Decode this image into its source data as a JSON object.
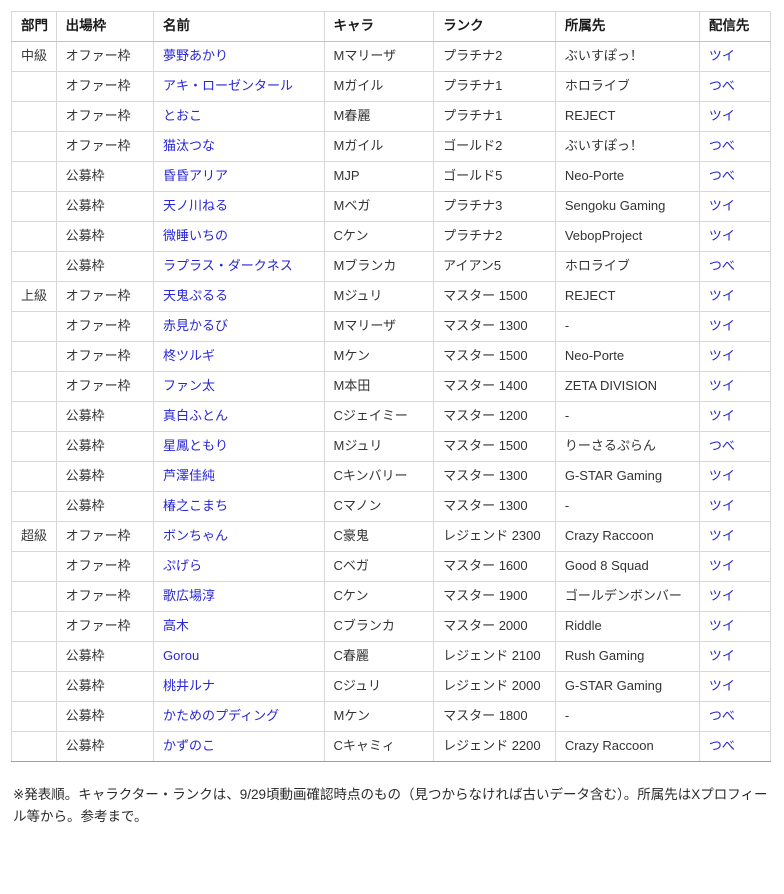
{
  "table": {
    "columns": [
      {
        "key": "bumon",
        "label": "部門"
      },
      {
        "key": "waku",
        "label": "出場枠"
      },
      {
        "key": "namae",
        "label": "名前"
      },
      {
        "key": "chara",
        "label": "キャラ"
      },
      {
        "key": "rank",
        "label": "ランク"
      },
      {
        "key": "shozoku",
        "label": "所属先"
      },
      {
        "key": "haishin",
        "label": "配信先"
      }
    ],
    "rows": [
      {
        "section_start": true,
        "bumon": "中級",
        "waku": "オファー枠",
        "namae": "夢野あかり",
        "chara": "Mマリーザ",
        "rank": "プラチナ2",
        "shozoku": "ぶいすぽっ！",
        "haishin": "ツイ"
      },
      {
        "section_start": false,
        "bumon": "",
        "waku": "オファー枠",
        "namae": "アキ・ローゼンタール",
        "chara": "Mガイル",
        "rank": "プラチナ1",
        "shozoku": "ホロライブ",
        "haishin": "つべ"
      },
      {
        "section_start": false,
        "bumon": "",
        "waku": "オファー枠",
        "namae": "とおこ",
        "chara": "M春麗",
        "rank": "プラチナ1",
        "shozoku": "REJECT",
        "haishin": "ツイ"
      },
      {
        "section_start": false,
        "bumon": "",
        "waku": "オファー枠",
        "namae": "猫汰つな",
        "chara": "Mガイル",
        "rank": "ゴールド2",
        "shozoku": "ぶいすぽっ！",
        "haishin": "つべ"
      },
      {
        "section_start": false,
        "bumon": "",
        "waku": "公募枠",
        "namae": "昏昏アリア",
        "chara": "MJP",
        "rank": "ゴールド5",
        "shozoku": "Neo-Porte",
        "haishin": "つべ"
      },
      {
        "section_start": false,
        "bumon": "",
        "waku": "公募枠",
        "namae": "天ノ川ねる",
        "chara": "Mベガ",
        "rank": "プラチナ3",
        "shozoku": "Sengoku Gaming",
        "haishin": "ツイ"
      },
      {
        "section_start": false,
        "bumon": "",
        "waku": "公募枠",
        "namae": "微睡いちの",
        "chara": "Cケン",
        "rank": "プラチナ2",
        "shozoku": "VebopProject",
        "haishin": "ツイ"
      },
      {
        "section_start": false,
        "bumon": "",
        "waku": "公募枠",
        "namae": "ラプラス・ダークネス",
        "chara": "Mブランカ",
        "rank": "アイアン5",
        "shozoku": "ホロライブ",
        "haishin": "つべ"
      },
      {
        "section_start": true,
        "bumon": "上級",
        "waku": "オファー枠",
        "namae": "天鬼ぷるる",
        "chara": "Mジュリ",
        "rank": "マスター 1500",
        "shozoku": "REJECT",
        "haishin": "ツイ"
      },
      {
        "section_start": false,
        "bumon": "",
        "waku": "オファー枠",
        "namae": "赤見かるび",
        "chara": "Mマリーザ",
        "rank": "マスター 1300",
        "shozoku": "-",
        "haishin": "ツイ"
      },
      {
        "section_start": false,
        "bumon": "",
        "waku": "オファー枠",
        "namae": "柊ツルギ",
        "chara": "Mケン",
        "rank": "マスター 1500",
        "shozoku": "Neo-Porte",
        "haishin": "ツイ"
      },
      {
        "section_start": false,
        "bumon": "",
        "waku": "オファー枠",
        "namae": "ファン太",
        "chara": "M本田",
        "rank": "マスター 1400",
        "shozoku": "ZETA DIVISION",
        "haishin": "ツイ"
      },
      {
        "section_start": false,
        "bumon": "",
        "waku": "公募枠",
        "namae": "真白ふとん",
        "chara": "Cジェイミー",
        "rank": "マスター 1200",
        "shozoku": "-",
        "haishin": "ツイ"
      },
      {
        "section_start": false,
        "bumon": "",
        "waku": "公募枠",
        "namae": "星鳳ともり",
        "chara": "Mジュリ",
        "rank": "マスター 1500",
        "shozoku": "りーさるぷらん",
        "haishin": "つべ"
      },
      {
        "section_start": false,
        "bumon": "",
        "waku": "公募枠",
        "namae": "芦澤佳純",
        "chara": "Cキンバリー",
        "rank": "マスター 1300",
        "shozoku": "G-STAR Gaming",
        "haishin": "ツイ"
      },
      {
        "section_start": false,
        "bumon": "",
        "waku": "公募枠",
        "namae": "椿之こまち",
        "chara": "Cマノン",
        "rank": "マスター 1300",
        "shozoku": "-",
        "haishin": "ツイ"
      },
      {
        "section_start": true,
        "bumon": "超級",
        "waku": "オファー枠",
        "namae": "ボンちゃん",
        "chara": "C豪鬼",
        "rank": "レジェンド 2300",
        "shozoku": "Crazy Raccoon",
        "haishin": "ツイ"
      },
      {
        "section_start": false,
        "bumon": "",
        "waku": "オファー枠",
        "namae": "ぷげら",
        "chara": "Cベガ",
        "rank": "マスター 1600",
        "shozoku": "Good 8 Squad",
        "haishin": "ツイ"
      },
      {
        "section_start": false,
        "bumon": "",
        "waku": "オファー枠",
        "namae": "歌広場淳",
        "chara": "Cケン",
        "rank": "マスター 1900",
        "shozoku": "ゴールデンボンバー",
        "haishin": "ツイ"
      },
      {
        "section_start": false,
        "bumon": "",
        "waku": "オファー枠",
        "namae": "高木",
        "chara": "Cブランカ",
        "rank": "マスター 2000",
        "shozoku": "Riddle",
        "haishin": "ツイ"
      },
      {
        "section_start": false,
        "bumon": "",
        "waku": "公募枠",
        "namae": "Gorou",
        "chara": "C春麗",
        "rank": "レジェンド 2100",
        "shozoku": "Rush Gaming",
        "haishin": "ツイ"
      },
      {
        "section_start": false,
        "bumon": "",
        "waku": "公募枠",
        "namae": "桃井ルナ",
        "chara": "Cジュリ",
        "rank": "レジェンド 2000",
        "shozoku": "G-STAR Gaming",
        "haishin": "ツイ"
      },
      {
        "section_start": false,
        "bumon": "",
        "waku": "公募枠",
        "namae": "かためのプディング",
        "chara": "Mケン",
        "rank": "マスター 1800",
        "shozoku": "-",
        "haishin": "つべ"
      },
      {
        "section_start": false,
        "bumon": "",
        "waku": "公募枠",
        "namae": "かずのこ",
        "chara": "Cキャミィ",
        "rank": "レジェンド 2200",
        "shozoku": "Crazy Raccoon",
        "haishin": "つべ"
      }
    ]
  },
  "footnote": {
    "text": "※発表順。キャラクター・ランクは、9/29頃動画確認時点のもの（見つからなければ古いデータ含む）。所属先はXプロフィール等から。参考まで。"
  },
  "colors": {
    "link": "#2826d6",
    "border": "#d5d7da",
    "section_border": "#9aa0a6",
    "text": "#333333"
  }
}
